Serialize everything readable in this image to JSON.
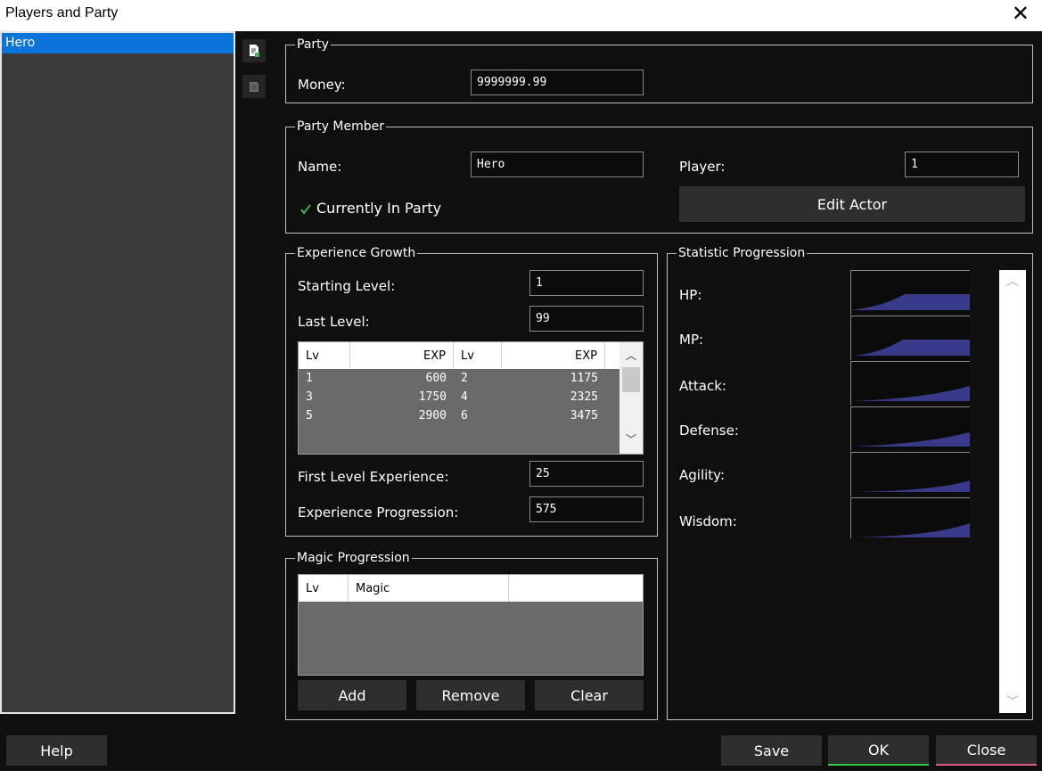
{
  "window": {
    "title": "Players and Party"
  },
  "left_list": {
    "items": [
      "Hero"
    ]
  },
  "party": {
    "legend": "Party",
    "money_label": "Money:",
    "money_value": "9999999.99"
  },
  "member": {
    "legend": "Party Member",
    "name_label": "Name:",
    "name_value": "Hero",
    "player_label": "Player:",
    "player_value": "1",
    "in_party_label": "Currently In Party",
    "in_party_checked": true,
    "edit_actor_label": "Edit Actor"
  },
  "exp": {
    "legend": "Experience Growth",
    "start_label": "Starting Level:",
    "start_value": "1",
    "last_label": "Last Level:",
    "last_value": "99",
    "columns": [
      "Lv",
      "EXP",
      "Lv",
      "EXP"
    ],
    "rows": [
      [
        "1",
        "600",
        "2",
        "1175"
      ],
      [
        "3",
        "1750",
        "4",
        "2325"
      ],
      [
        "5",
        "2900",
        "6",
        "3475"
      ]
    ],
    "first_label": "First Level Experience:",
    "first_value": "25",
    "prog_label": "Experience Progression:",
    "prog_value": "575"
  },
  "magic": {
    "legend": "Magic Progression",
    "columns": [
      "Lv",
      "Magic",
      ""
    ],
    "add_label": "Add",
    "remove_label": "Remove",
    "clear_label": "Clear"
  },
  "stats": {
    "legend": "Statistic Progression",
    "items": [
      {
        "label": "HP:"
      },
      {
        "label": "MP:"
      },
      {
        "label": "Attack:"
      },
      {
        "label": "Defense:"
      },
      {
        "label": "Agility:"
      },
      {
        "label": "Wisdom:"
      }
    ],
    "graph_color": "#3a3a8a"
  },
  "footer": {
    "help_label": "Help",
    "save_label": "Save",
    "ok_label": "OK",
    "close_label": "Close"
  },
  "colors": {
    "selection": "#0a74da",
    "ok_accent": "#2ecc40",
    "close_accent": "#e05a7a",
    "check": "#4caf50"
  }
}
